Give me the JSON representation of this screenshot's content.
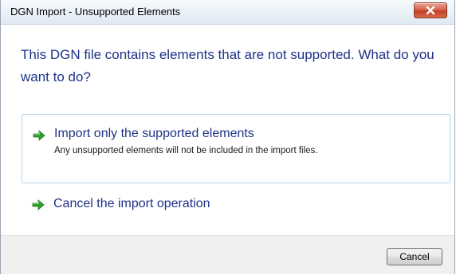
{
  "window": {
    "title": "DGN Import - Unsupported Elements",
    "close_icon": "close-icon"
  },
  "main": {
    "instruction": "This DGN file contains elements that are not supported. What do you want to do?"
  },
  "options": [
    {
      "icon": "green-arrow-icon",
      "title": "Import only the supported elements",
      "description": "Any unsupported elements will not be included in the import files."
    },
    {
      "icon": "green-arrow-icon",
      "title": "Cancel the import operation"
    }
  ],
  "footer": {
    "cancel_label": "Cancel"
  },
  "colors": {
    "instruction_text": "#1e3287",
    "arrow": "#2e9e2e",
    "close_button": "#c9482b"
  }
}
